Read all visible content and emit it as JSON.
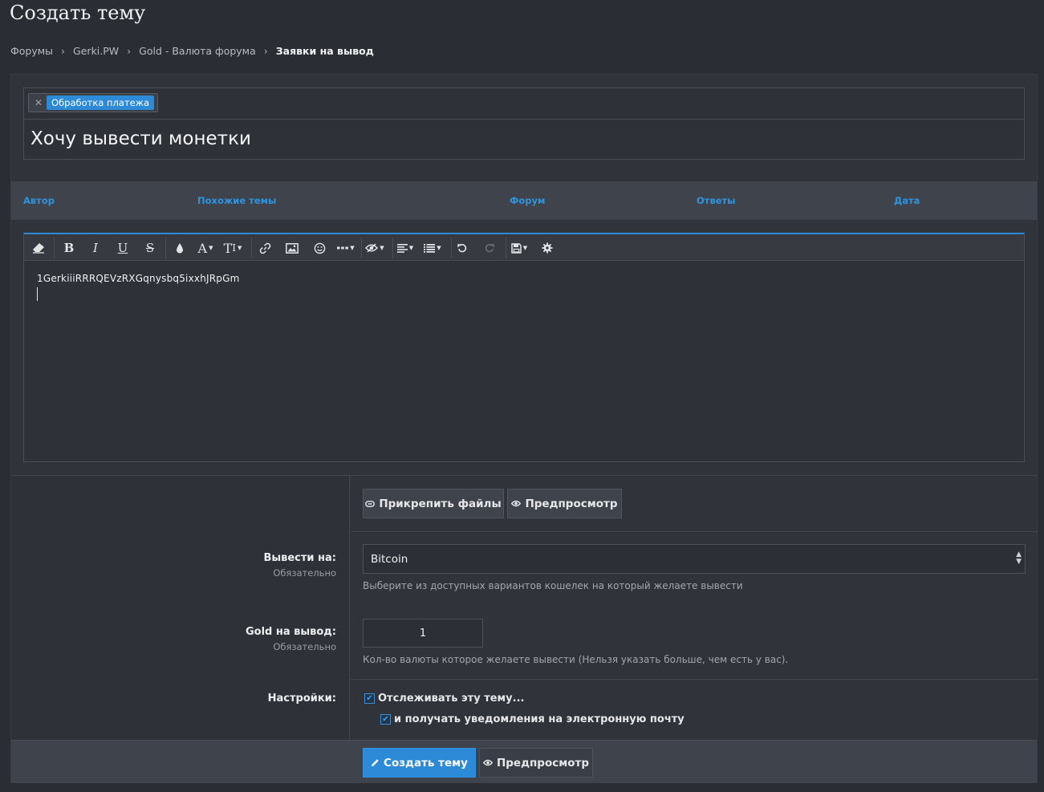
{
  "page": {
    "title": "Создать тему"
  },
  "breadcrumb": [
    {
      "label": "Форумы"
    },
    {
      "label": "Gerki.PW"
    },
    {
      "label": "Gold - Валюта форума"
    },
    {
      "label": "Заявки на вывод"
    }
  ],
  "breadcrumb_separator": "›",
  "prefix": {
    "remove_glyph": "✕",
    "label": "Обработка платежа",
    "color": "#2c8ad6"
  },
  "thread_title": "Хочу вывести монетки",
  "similar_threads": {
    "columns": [
      "Автор",
      "Похожие темы",
      "Форум",
      "Ответы",
      "Дата"
    ]
  },
  "editor": {
    "toolbar_icons": [
      "eraser-icon",
      "bold-icon",
      "italic-icon",
      "underline-icon",
      "strikethrough-icon",
      "text-color-icon",
      "font-family-icon",
      "font-size-icon",
      "link-icon",
      "image-icon",
      "smilie-icon",
      "more-insert-icon",
      "hide-icon",
      "align-icon",
      "list-icon",
      "undo-icon",
      "redo-icon",
      "drafts-icon",
      "settings-icon"
    ],
    "toolbar_glyphs": {
      "bold": "B",
      "italic": "I",
      "underline": "U",
      "strike": "S",
      "font_family": "A",
      "font_size": "T"
    },
    "content": "1GerkiiiRRRQEVzRXGqnysbq5ixxhJRpGm"
  },
  "attach_button": "Прикрепить файлы",
  "preview_button": "Предпросмотр",
  "fields": {
    "withdraw_to": {
      "label": "Вывести на:",
      "required": "Обязательно",
      "value": "Bitcoin",
      "hint": "Выберите из доступных вариантов кошелек на который желаете вывести"
    },
    "gold_amount": {
      "label": "Gold на вывод:",
      "required": "Обязательно",
      "value": "1",
      "hint": "Кол-во валюты которое желаете вывести (Нельзя указать больше, чем есть у вас)."
    },
    "settings": {
      "label": "Настройки:",
      "watch_thread": "Отслеживать эту тему...",
      "email_notify": "и получать уведомления на электронную почту",
      "watch_checked": true,
      "email_checked": true
    }
  },
  "footer": {
    "create_button": "Создать тему",
    "preview_button": "Предпросмотр"
  },
  "colors": {
    "accent": "#2c8ad6",
    "background": "#2a2d33",
    "panel": "#30333a",
    "header_link": "#2e93e0"
  }
}
